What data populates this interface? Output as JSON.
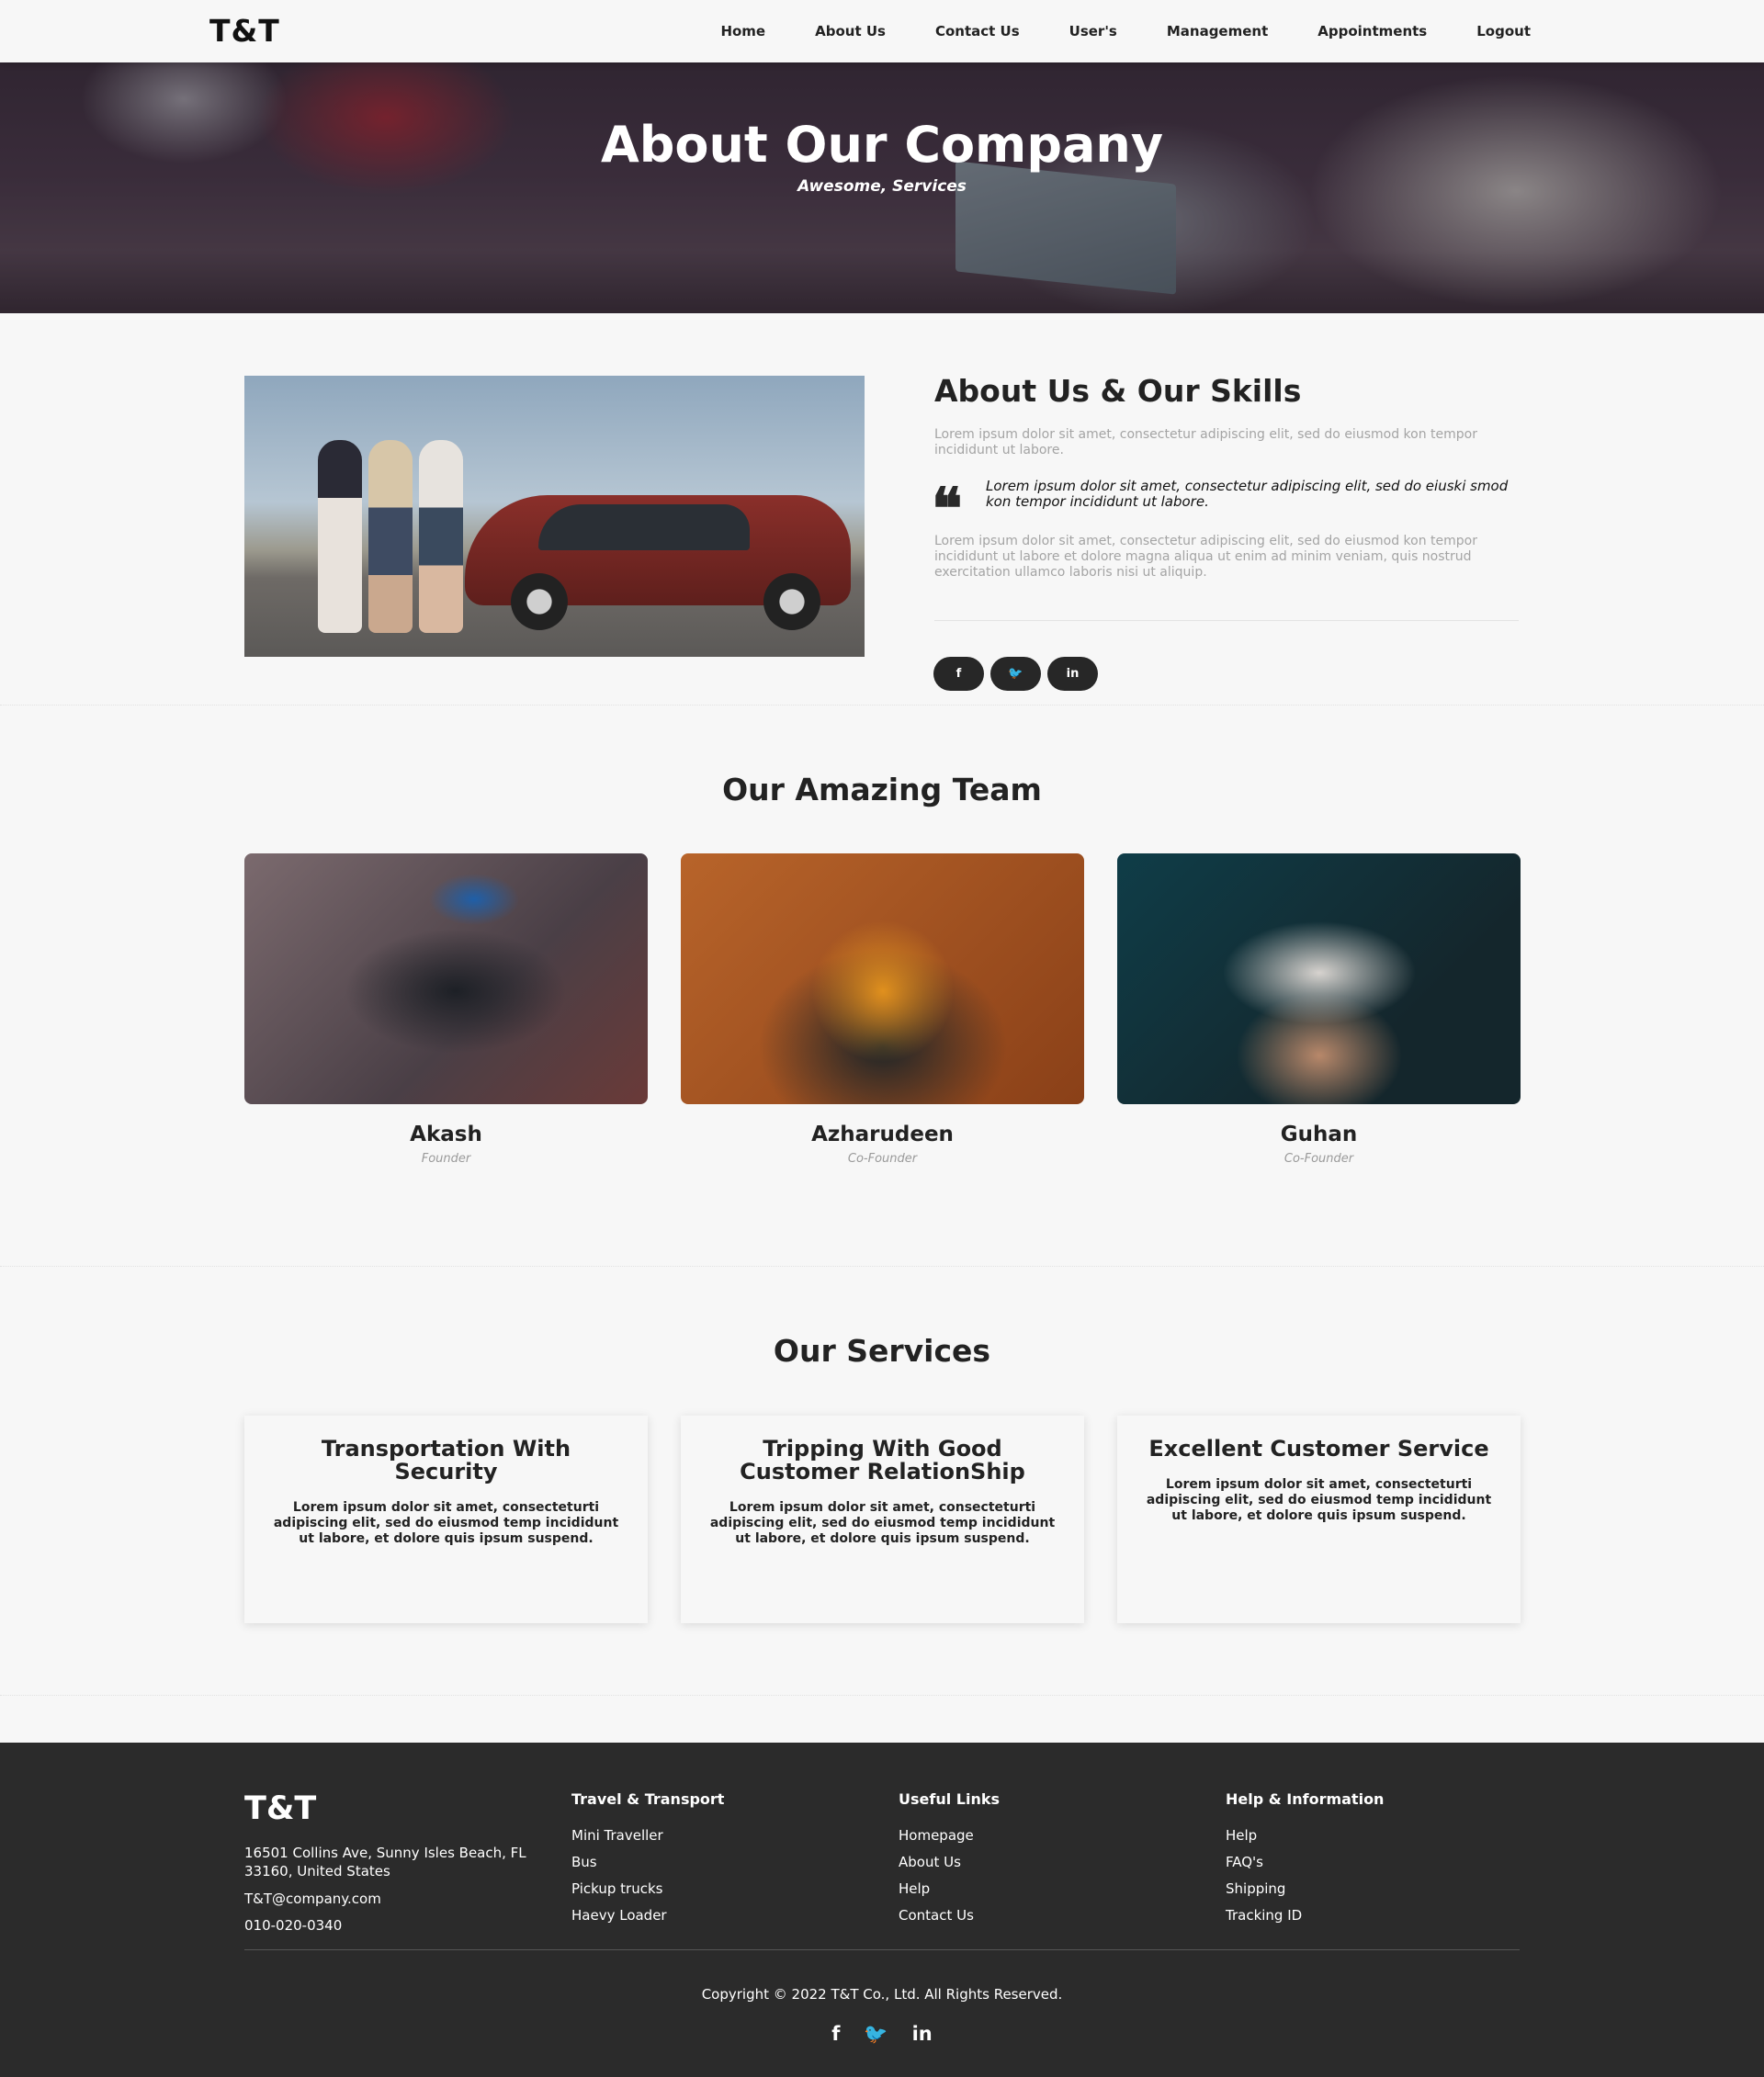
{
  "nav": {
    "brand": "T&T",
    "links": [
      "Home",
      "About Us",
      "Contact Us",
      "User's",
      "Management",
      "Appointments",
      "Logout"
    ]
  },
  "hero": {
    "title": "About Our Company",
    "subtitle": "Awesome, Services"
  },
  "about": {
    "heading": "About Us & Our Skills",
    "paragraph1": "Lorem ipsum dolor sit amet, consectetur adipiscing elit, sed do eiusmod kon tempor incididunt ut labore.",
    "quote": "Lorem ipsum dolor sit amet, consectetur adipiscing elit, sed do eiuski smod kon tempor incididunt ut labore.",
    "paragraph2": "Lorem ipsum dolor sit amet, consectetur adipiscing elit, sed do eiusmod kon tempor incididunt ut labore et dolore magna aliqua ut enim ad minim veniam, quis nostrud exercitation ullamco laboris nisi ut aliquip.",
    "social": [
      {
        "icon": "facebook-icon",
        "glyph": "f"
      },
      {
        "icon": "twitter-icon",
        "glyph": "🐦"
      },
      {
        "icon": "linkedin-icon",
        "glyph": "in"
      }
    ]
  },
  "team": {
    "title": "Our Amazing Team",
    "members": [
      {
        "name": "Akash",
        "role": "Founder"
      },
      {
        "name": "Azharudeen",
        "role": "Co-Founder"
      },
      {
        "name": "Guhan",
        "role": "Co-Founder"
      }
    ]
  },
  "services": {
    "title": "Our Services",
    "items": [
      {
        "title": "Transportation With Security",
        "text": "Lorem ipsum dolor sit amet, consecteturti adipiscing elit, sed do eiusmod temp incididunt ut labore, et dolore quis ipsum suspend."
      },
      {
        "title": "Tripping With Good Customer RelationShip",
        "text": "Lorem ipsum dolor sit amet, consecteturti adipiscing elit, sed do eiusmod temp incididunt ut labore, et dolore quis ipsum suspend."
      },
      {
        "title": "Excellent Customer Service",
        "text": "Lorem ipsum dolor sit amet, consecteturti adipiscing elit, sed do eiusmod temp incididunt ut labore, et dolore quis ipsum suspend."
      }
    ]
  },
  "footer": {
    "brand": "T&T",
    "address": "16501 Collins Ave, Sunny Isles Beach, FL 33160, United States",
    "email": "T&T@company.com",
    "phone": "010-020-0340",
    "columns": [
      {
        "title": "Travel & Transport",
        "links": [
          "Mini Traveller",
          "Bus",
          "Pickup trucks",
          "Haevy Loader"
        ]
      },
      {
        "title": "Useful Links",
        "links": [
          "Homepage",
          "About Us",
          "Help",
          "Contact Us"
        ]
      },
      {
        "title": "Help & Information",
        "links": [
          "Help",
          "FAQ's",
          "Shipping",
          "Tracking ID"
        ]
      }
    ],
    "copyright": "Copyright © 2022 T&T Co., Ltd. All Rights Reserved.",
    "social": [
      {
        "icon": "facebook-icon",
        "glyph": "f"
      },
      {
        "icon": "twitter-icon",
        "glyph": "🐦"
      },
      {
        "icon": "linkedin-icon",
        "glyph": "in"
      }
    ]
  }
}
